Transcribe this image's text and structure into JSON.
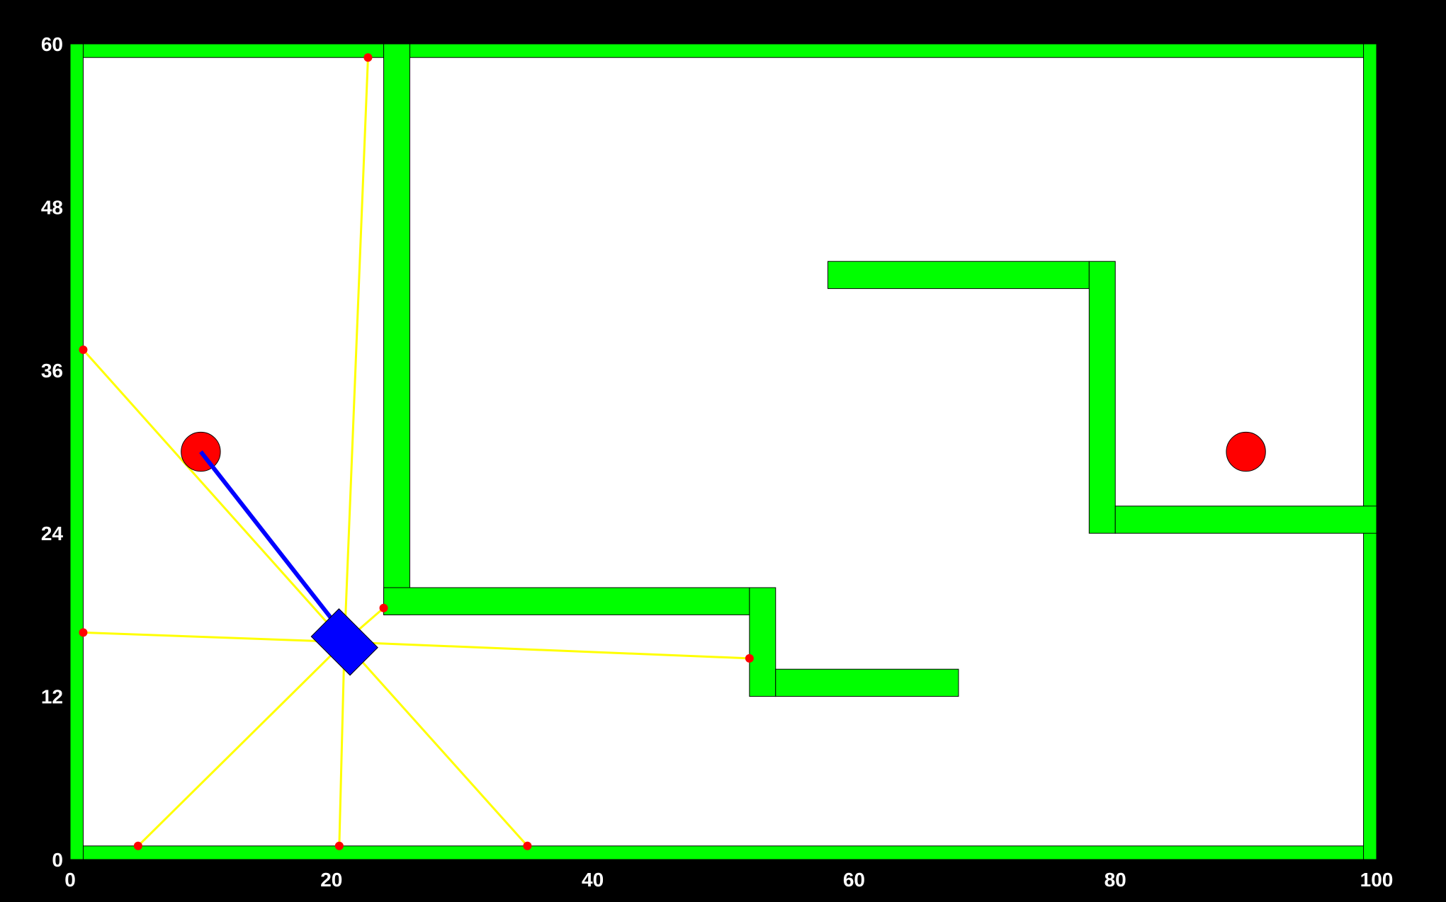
{
  "colors": {
    "background": "#000000",
    "field": "#ffffff",
    "wall": "#00ff00",
    "wall_outline": "#000000",
    "robot": "#0000ff",
    "heading_line": "#0000ff",
    "lidar_ray": "#ffff00",
    "lidar_hit": "#ff0000",
    "target": "#ff0000",
    "tick_text": "#ffffff"
  },
  "axes": {
    "x_ticks": [
      "0",
      "20",
      "40",
      "60",
      "80",
      "100"
    ],
    "y_ticks": [
      "0",
      "12",
      "24",
      "36",
      "48",
      "60"
    ]
  },
  "world": {
    "x_range": [
      0,
      100
    ],
    "y_range": [
      0,
      60
    ],
    "walls": [
      {
        "name": "wall-bottom-border",
        "x": [
          0,
          100
        ],
        "y": [
          0,
          1
        ]
      },
      {
        "name": "wall-top-border",
        "x": [
          0,
          100
        ],
        "y": [
          59,
          60
        ]
      },
      {
        "name": "wall-left-border",
        "x": [
          0,
          1
        ],
        "y": [
          0,
          60
        ]
      },
      {
        "name": "wall-right-border",
        "x": [
          99,
          100
        ],
        "y": [
          0,
          60
        ]
      },
      {
        "name": "wall-vertical-divider",
        "x": [
          24,
          26
        ],
        "y": [
          18,
          60
        ]
      },
      {
        "name": "wall-lower-horizontal",
        "x": [
          24,
          52
        ],
        "y": [
          18,
          20
        ]
      },
      {
        "name": "wall-lower-step",
        "x": [
          52,
          54
        ],
        "y": [
          12,
          20
        ]
      },
      {
        "name": "wall-lower-shelf",
        "x": [
          54,
          68
        ],
        "y": [
          12,
          14
        ]
      },
      {
        "name": "wall-upper-horizontal",
        "x": [
          58,
          78
        ],
        "y": [
          42,
          44
        ]
      },
      {
        "name": "wall-upper-step",
        "x": [
          78,
          80
        ],
        "y": [
          24,
          44
        ]
      },
      {
        "name": "wall-right-shelf",
        "x": [
          80,
          100
        ],
        "y": [
          24,
          26
        ]
      }
    ],
    "targets": [
      {
        "name": "target-left",
        "x": 10,
        "y": 30,
        "r": 1.5
      },
      {
        "name": "target-right",
        "x": 90,
        "y": 30,
        "r": 1.5
      }
    ],
    "robot": {
      "x": 21,
      "y": 16,
      "length": 4.2,
      "width": 3.0,
      "heading_deg": -45
    },
    "heading_line": {
      "from": [
        21,
        16.5
      ],
      "to": [
        10,
        30
      ]
    },
    "lidar": {
      "origin": [
        21,
        16
      ],
      "hits": [
        [
          22.8,
          59
        ],
        [
          1,
          37.5
        ],
        [
          1,
          16.7
        ],
        [
          24,
          18.5
        ],
        [
          52,
          14.8
        ],
        [
          5.2,
          1
        ],
        [
          20.6,
          1
        ],
        [
          35,
          1
        ]
      ]
    }
  }
}
